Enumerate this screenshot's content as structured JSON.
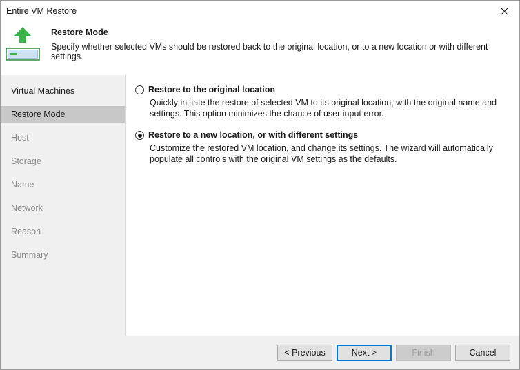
{
  "window": {
    "title": "Entire VM Restore"
  },
  "header": {
    "title": "Restore Mode",
    "description": "Specify whether selected VMs should be restored back to the original location, or to a new location or with different settings."
  },
  "sidebar": {
    "items": [
      {
        "label": "Virtual Machines",
        "state": "enabled"
      },
      {
        "label": "Restore Mode",
        "state": "active"
      },
      {
        "label": "Host",
        "state": "disabled"
      },
      {
        "label": "Storage",
        "state": "disabled"
      },
      {
        "label": "Name",
        "state": "disabled"
      },
      {
        "label": "Network",
        "state": "disabled"
      },
      {
        "label": "Reason",
        "state": "disabled"
      },
      {
        "label": "Summary",
        "state": "disabled"
      }
    ]
  },
  "options": [
    {
      "label": "Restore to the original location",
      "description": "Quickly initiate the restore of selected VM to its original location, with the original name and settings. This option minimizes the chance of user input error.",
      "checked": false
    },
    {
      "label": "Restore to a new location, or with different settings",
      "description": "Customize the restored VM location, and change its settings. The wizard will automatically populate all controls with the original VM settings as the defaults.",
      "checked": true
    }
  ],
  "footer": {
    "previous": "< Previous",
    "next": "Next >",
    "finish": "Finish",
    "cancel": "Cancel"
  },
  "colors": {
    "arrow": "#3cb24a",
    "server": "#2e8b3e",
    "accent": "#0078d7",
    "active_nav": "#c8c8c8"
  }
}
